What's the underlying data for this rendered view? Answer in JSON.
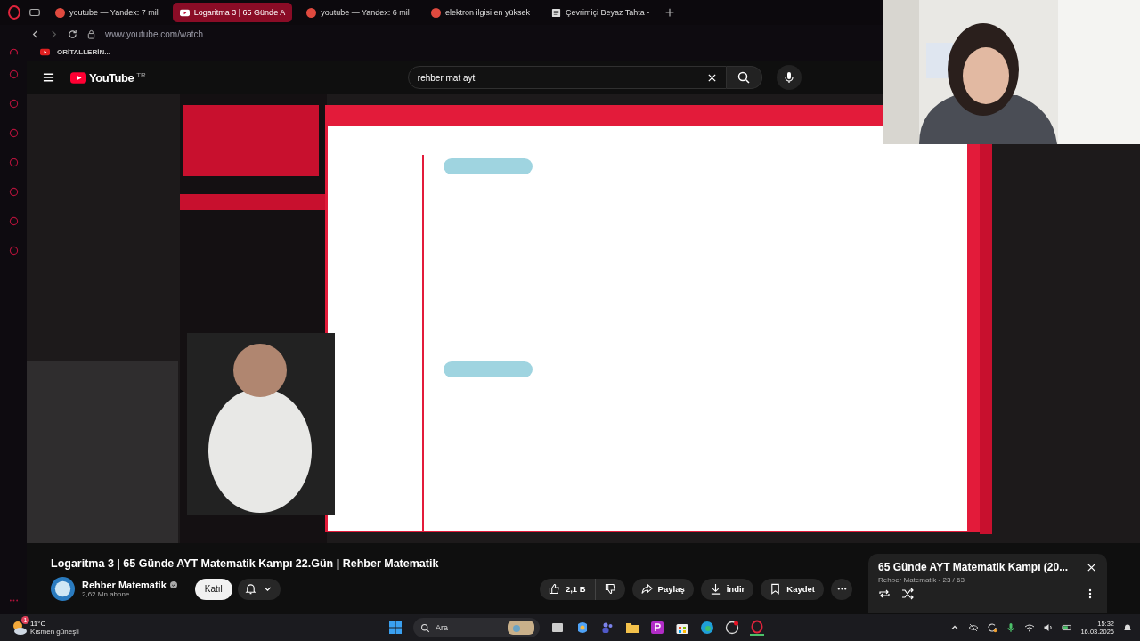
{
  "browser": {
    "tabs": [
      {
        "title": "youtube — Yandex: 7 mil",
        "kind": "search",
        "selected": false
      },
      {
        "title": "Logaritma 3 | 65 Günde A",
        "kind": "video",
        "selected": true
      },
      {
        "title": "youtube — Yandex: 6 mil",
        "kind": "search",
        "selected": false
      },
      {
        "title": "elektron ilgisi en yüksek",
        "kind": "search",
        "selected": false
      },
      {
        "title": "Çevrimiçi Beyaz Tahta -",
        "kind": "note",
        "selected": false
      }
    ],
    "address": "www.youtube.com/watch",
    "bookmark": "ORİTALLERİN..."
  },
  "youtube": {
    "logo": "YouTube",
    "region": "TR",
    "search": {
      "value": "rehber mat ayt"
    }
  },
  "title": "Logaritma 3 | 65 Günde AYT Matematik Kampı 22.Gün | Rehber Matematik",
  "channel": {
    "name": "Rehber Matematik",
    "verified": true,
    "subscribers": "2,62 Mn abone",
    "join": "Katıl"
  },
  "actions": [
    {
      "kind": "like",
      "label": "2,1 B"
    },
    {
      "kind": "dislike"
    },
    {
      "kind": "share",
      "label": "Paylaş"
    },
    {
      "kind": "download",
      "label": "İndir"
    },
    {
      "kind": "save",
      "label": "Kaydet"
    },
    {
      "kind": "more"
    }
  ],
  "playlist": {
    "title": "65 Günde AYT Matematik Kampı (20...",
    "meta": "Rehber Matematik - 23 / 63"
  },
  "taskbar": {
    "weather": {
      "temp": "11°C",
      "desc": "Kısmen güneşli",
      "badge": "1"
    },
    "search": {
      "placeholder": "Ara"
    },
    "time": "15:32",
    "date": "16.03.2026"
  }
}
